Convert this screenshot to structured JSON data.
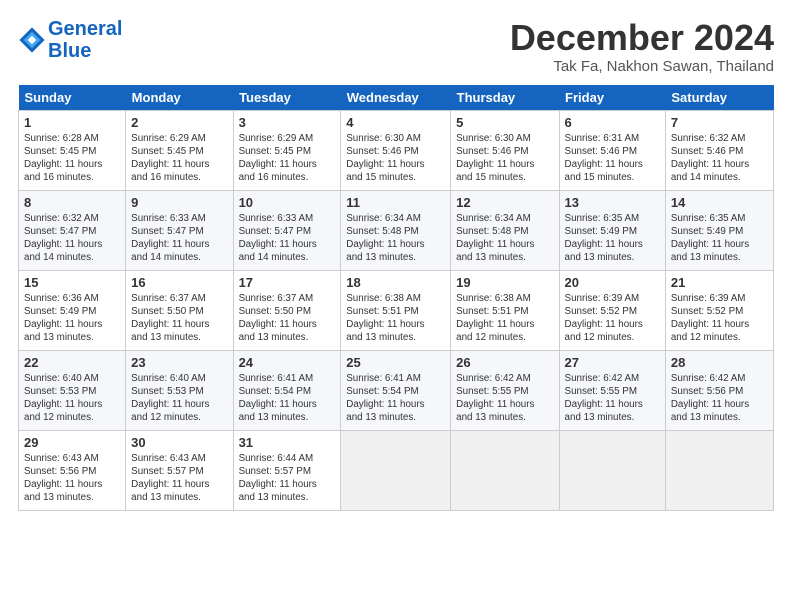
{
  "header": {
    "logo_line1": "General",
    "logo_line2": "Blue",
    "month_title": "December 2024",
    "location": "Tak Fa, Nakhon Sawan, Thailand"
  },
  "weekdays": [
    "Sunday",
    "Monday",
    "Tuesday",
    "Wednesday",
    "Thursday",
    "Friday",
    "Saturday"
  ],
  "weeks": [
    [
      {
        "day": "1",
        "info": "Sunrise: 6:28 AM\nSunset: 5:45 PM\nDaylight: 11 hours\nand 16 minutes."
      },
      {
        "day": "2",
        "info": "Sunrise: 6:29 AM\nSunset: 5:45 PM\nDaylight: 11 hours\nand 16 minutes."
      },
      {
        "day": "3",
        "info": "Sunrise: 6:29 AM\nSunset: 5:45 PM\nDaylight: 11 hours\nand 16 minutes."
      },
      {
        "day": "4",
        "info": "Sunrise: 6:30 AM\nSunset: 5:46 PM\nDaylight: 11 hours\nand 15 minutes."
      },
      {
        "day": "5",
        "info": "Sunrise: 6:30 AM\nSunset: 5:46 PM\nDaylight: 11 hours\nand 15 minutes."
      },
      {
        "day": "6",
        "info": "Sunrise: 6:31 AM\nSunset: 5:46 PM\nDaylight: 11 hours\nand 15 minutes."
      },
      {
        "day": "7",
        "info": "Sunrise: 6:32 AM\nSunset: 5:46 PM\nDaylight: 11 hours\nand 14 minutes."
      }
    ],
    [
      {
        "day": "8",
        "info": "Sunrise: 6:32 AM\nSunset: 5:47 PM\nDaylight: 11 hours\nand 14 minutes."
      },
      {
        "day": "9",
        "info": "Sunrise: 6:33 AM\nSunset: 5:47 PM\nDaylight: 11 hours\nand 14 minutes."
      },
      {
        "day": "10",
        "info": "Sunrise: 6:33 AM\nSunset: 5:47 PM\nDaylight: 11 hours\nand 14 minutes."
      },
      {
        "day": "11",
        "info": "Sunrise: 6:34 AM\nSunset: 5:48 PM\nDaylight: 11 hours\nand 13 minutes."
      },
      {
        "day": "12",
        "info": "Sunrise: 6:34 AM\nSunset: 5:48 PM\nDaylight: 11 hours\nand 13 minutes."
      },
      {
        "day": "13",
        "info": "Sunrise: 6:35 AM\nSunset: 5:49 PM\nDaylight: 11 hours\nand 13 minutes."
      },
      {
        "day": "14",
        "info": "Sunrise: 6:35 AM\nSunset: 5:49 PM\nDaylight: 11 hours\nand 13 minutes."
      }
    ],
    [
      {
        "day": "15",
        "info": "Sunrise: 6:36 AM\nSunset: 5:49 PM\nDaylight: 11 hours\nand 13 minutes."
      },
      {
        "day": "16",
        "info": "Sunrise: 6:37 AM\nSunset: 5:50 PM\nDaylight: 11 hours\nand 13 minutes."
      },
      {
        "day": "17",
        "info": "Sunrise: 6:37 AM\nSunset: 5:50 PM\nDaylight: 11 hours\nand 13 minutes."
      },
      {
        "day": "18",
        "info": "Sunrise: 6:38 AM\nSunset: 5:51 PM\nDaylight: 11 hours\nand 13 minutes."
      },
      {
        "day": "19",
        "info": "Sunrise: 6:38 AM\nSunset: 5:51 PM\nDaylight: 11 hours\nand 12 minutes."
      },
      {
        "day": "20",
        "info": "Sunrise: 6:39 AM\nSunset: 5:52 PM\nDaylight: 11 hours\nand 12 minutes."
      },
      {
        "day": "21",
        "info": "Sunrise: 6:39 AM\nSunset: 5:52 PM\nDaylight: 11 hours\nand 12 minutes."
      }
    ],
    [
      {
        "day": "22",
        "info": "Sunrise: 6:40 AM\nSunset: 5:53 PM\nDaylight: 11 hours\nand 12 minutes."
      },
      {
        "day": "23",
        "info": "Sunrise: 6:40 AM\nSunset: 5:53 PM\nDaylight: 11 hours\nand 12 minutes."
      },
      {
        "day": "24",
        "info": "Sunrise: 6:41 AM\nSunset: 5:54 PM\nDaylight: 11 hours\nand 13 minutes."
      },
      {
        "day": "25",
        "info": "Sunrise: 6:41 AM\nSunset: 5:54 PM\nDaylight: 11 hours\nand 13 minutes."
      },
      {
        "day": "26",
        "info": "Sunrise: 6:42 AM\nSunset: 5:55 PM\nDaylight: 11 hours\nand 13 minutes."
      },
      {
        "day": "27",
        "info": "Sunrise: 6:42 AM\nSunset: 5:55 PM\nDaylight: 11 hours\nand 13 minutes."
      },
      {
        "day": "28",
        "info": "Sunrise: 6:42 AM\nSunset: 5:56 PM\nDaylight: 11 hours\nand 13 minutes."
      }
    ],
    [
      {
        "day": "29",
        "info": "Sunrise: 6:43 AM\nSunset: 5:56 PM\nDaylight: 11 hours\nand 13 minutes."
      },
      {
        "day": "30",
        "info": "Sunrise: 6:43 AM\nSunset: 5:57 PM\nDaylight: 11 hours\nand 13 minutes."
      },
      {
        "day": "31",
        "info": "Sunrise: 6:44 AM\nSunset: 5:57 PM\nDaylight: 11 hours\nand 13 minutes."
      },
      {
        "day": "",
        "info": ""
      },
      {
        "day": "",
        "info": ""
      },
      {
        "day": "",
        "info": ""
      },
      {
        "day": "",
        "info": ""
      }
    ]
  ]
}
